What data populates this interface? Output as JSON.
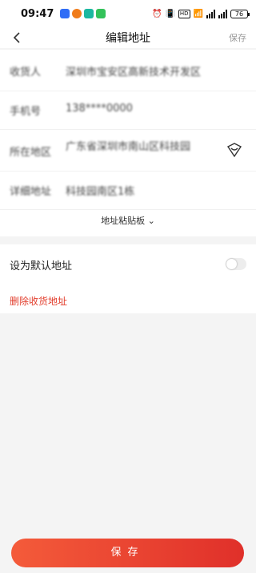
{
  "status_bar": {
    "time": "09:47",
    "battery": "76",
    "hd_badge": "HD"
  },
  "nav": {
    "title": "编辑地址",
    "save_label": "保存"
  },
  "form": {
    "rows": [
      {
        "label": "收货人",
        "value": "深圳市宝安区高新技术开发区"
      },
      {
        "label": "手机号",
        "value": "138****0000"
      },
      {
        "label": "所在地区",
        "value": "广东省深圳市南山区科技园"
      },
      {
        "label": "详细地址",
        "value": "科技园南区1栋"
      }
    ],
    "paste_toggle_label": "地址粘贴板"
  },
  "default_address": {
    "label": "设为默认地址",
    "enabled": false
  },
  "delete_label": "删除收货地址",
  "bottom": {
    "save_label": "保存"
  },
  "colors": {
    "accent": "#e0302a",
    "delete_text": "#e23d2c"
  }
}
